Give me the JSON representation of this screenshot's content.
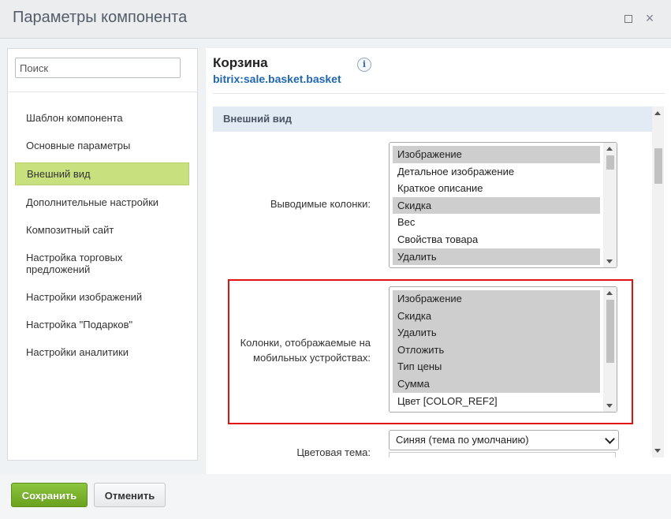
{
  "window": {
    "title": "Параметры компонента",
    "maximize_icon": "maximize-icon",
    "close_icon": "close-icon",
    "close_glyph": "×"
  },
  "sidebar": {
    "search_placeholder": "Поиск",
    "items": [
      {
        "label": "Шаблон компонента"
      },
      {
        "label": "Основные параметры"
      },
      {
        "label": "Внешний вид",
        "active": true
      },
      {
        "label": "Дополнительные настройки"
      },
      {
        "label": "Композитный сайт"
      },
      {
        "label": "Настройка торговых предложений"
      },
      {
        "label": "Настройки изображений"
      },
      {
        "label": "Настройка \"Подарков\""
      },
      {
        "label": "Настройки аналитики"
      }
    ]
  },
  "component": {
    "title": "Корзина",
    "id": "bitrix:sale.basket.basket",
    "info_glyph": "i"
  },
  "section": {
    "title": "Внешний вид"
  },
  "fields": {
    "columns": {
      "label": "Выводимые колонки:",
      "options": [
        {
          "text": "Изображение",
          "selected": true
        },
        {
          "text": "Детальное изображение",
          "selected": false
        },
        {
          "text": "Краткое описание",
          "selected": false
        },
        {
          "text": "Скидка",
          "selected": true
        },
        {
          "text": "Вес",
          "selected": false
        },
        {
          "text": "Свойства товара",
          "selected": false
        },
        {
          "text": "Удалить",
          "selected": true
        }
      ]
    },
    "mobile_columns": {
      "label": "Колонки, отображаемые на мобильных устройствах:",
      "options": [
        {
          "text": "Изображение",
          "selected": true
        },
        {
          "text": "Скидка",
          "selected": true
        },
        {
          "text": "Удалить",
          "selected": true
        },
        {
          "text": "Отложить",
          "selected": true
        },
        {
          "text": "Тип цены",
          "selected": true
        },
        {
          "text": "Сумма",
          "selected": true
        },
        {
          "text": "Цвет [COLOR_REF2]",
          "selected": false
        }
      ]
    },
    "theme": {
      "label": "Цветовая тема:",
      "value": "Синяя (тема по умолчанию)"
    }
  },
  "footer": {
    "save_label": "Сохранить",
    "cancel_label": "Отменить"
  },
  "colors": {
    "save_button": "#7ab22e",
    "active_nav": "#c8e07e",
    "section_header": "#e2ebf4",
    "highlight_border": "#e31212",
    "component_id": "#2067b0"
  }
}
